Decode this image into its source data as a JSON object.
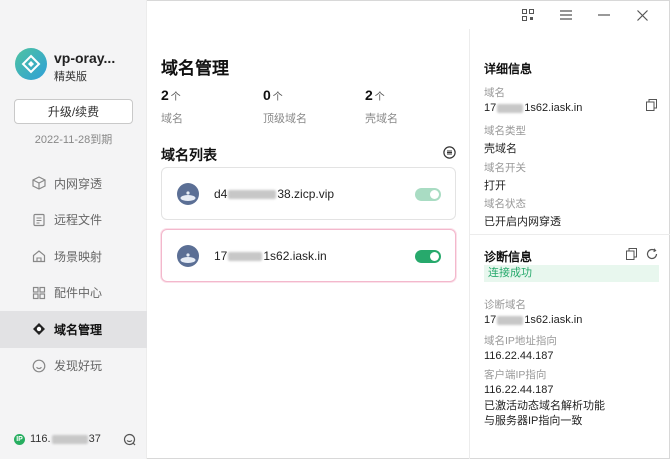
{
  "app": {
    "name": "vp-oray...",
    "edition": "精英版",
    "upgrade_label": "升级/续费",
    "expire": "2022-11-28到期"
  },
  "nav": [
    {
      "label": "内网穿透",
      "icon": "tunnel-icon"
    },
    {
      "label": "远程文件",
      "icon": "file-icon"
    },
    {
      "label": "场景映射",
      "icon": "home-icon"
    },
    {
      "label": "配件中心",
      "icon": "grid-icon"
    },
    {
      "label": "域名管理",
      "icon": "domain-icon"
    },
    {
      "label": "发现好玩",
      "icon": "smile-icon"
    }
  ],
  "footer": {
    "ip_prefix": "116.",
    "ip_suffix": "37",
    "badge": "IP"
  },
  "main": {
    "title": "域名管理",
    "stats": [
      {
        "num": "2",
        "unit": "个",
        "label": "域名"
      },
      {
        "num": "0",
        "unit": "个",
        "label": "顶级域名"
      },
      {
        "num": "2",
        "unit": "个",
        "label": "壳域名"
      }
    ],
    "list_title": "域名列表",
    "domains": [
      {
        "prefix": "d4",
        "suffix": "38.zicp.vip",
        "enabled": true,
        "selected": false
      },
      {
        "prefix": "17",
        "suffix": "1s62.iask.in",
        "enabled": true,
        "selected": true
      }
    ]
  },
  "detail": {
    "title": "详细信息",
    "domain_label": "域名",
    "domain_prefix": "17",
    "domain_suffix": "1s62.iask.in",
    "type_label": "域名类型",
    "type_value": "壳域名",
    "switch_label": "域名开关",
    "switch_value": "打开",
    "status_label": "域名状态",
    "status_value": "已开启内网穿透"
  },
  "diag": {
    "title": "诊断信息",
    "result": "连接成功",
    "domain_label": "诊断域名",
    "domain_prefix": "17",
    "domain_suffix": "1s62.iask.in",
    "ip_label": "域名IP地址指向",
    "ip_value": "116.22.44.187",
    "client_label": "客户端IP指向",
    "client_value": "116.22.44.187",
    "note_line1": "已激活动态域名解析功能",
    "note_line2": "与服务器IP指向一致"
  },
  "colors": {
    "accent": "#27a96c",
    "selected_border": "#f3b8cc",
    "sidebar_bg": "#f4f4f5"
  }
}
